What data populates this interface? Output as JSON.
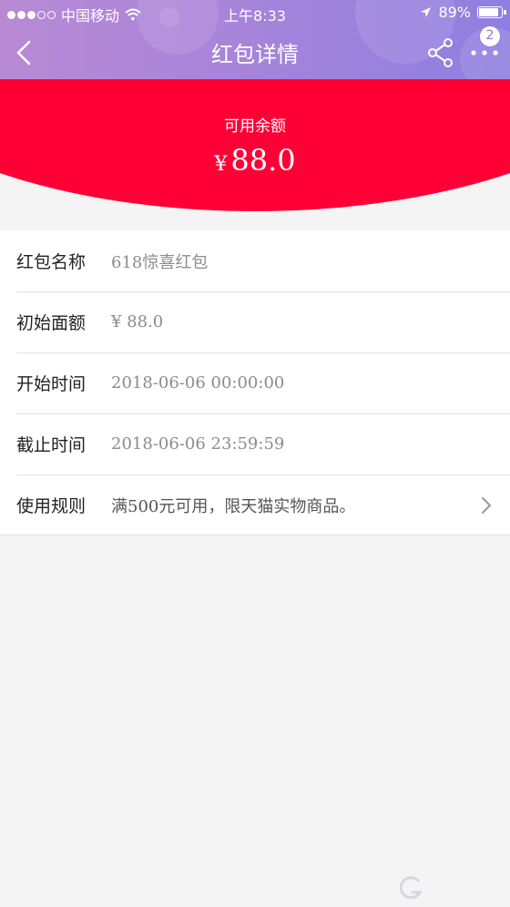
{
  "status_bar": {
    "carrier": "中国移动",
    "time": "上午8:33",
    "battery": "89%",
    "battery_level": 0.89
  },
  "nav": {
    "title": "红包详情",
    "back_icon": "chevron-left-icon",
    "share_icon": "share-icon",
    "more_icon": "more-icon",
    "badge_count": "2"
  },
  "balance": {
    "label": "可用余额",
    "currency": "¥",
    "amount": "88.0"
  },
  "details": [
    {
      "label": "红包名称",
      "value": "618惊喜红包"
    },
    {
      "label": "初始面额",
      "value": "¥ 88.0"
    },
    {
      "label": "开始时间",
      "value": "2018-06-06 00:00:00"
    },
    {
      "label": "截止时间",
      "value": "2018-06-06 23:59:59"
    },
    {
      "label": "使用规则",
      "value": "满500元可用，限天猫实物商品。"
    }
  ],
  "colors": {
    "header_gradient_start": "#b98ad4",
    "header_gradient_end": "#8e7fe0",
    "balance_red": "#ff0036",
    "page_background": "#f4f4f4"
  }
}
